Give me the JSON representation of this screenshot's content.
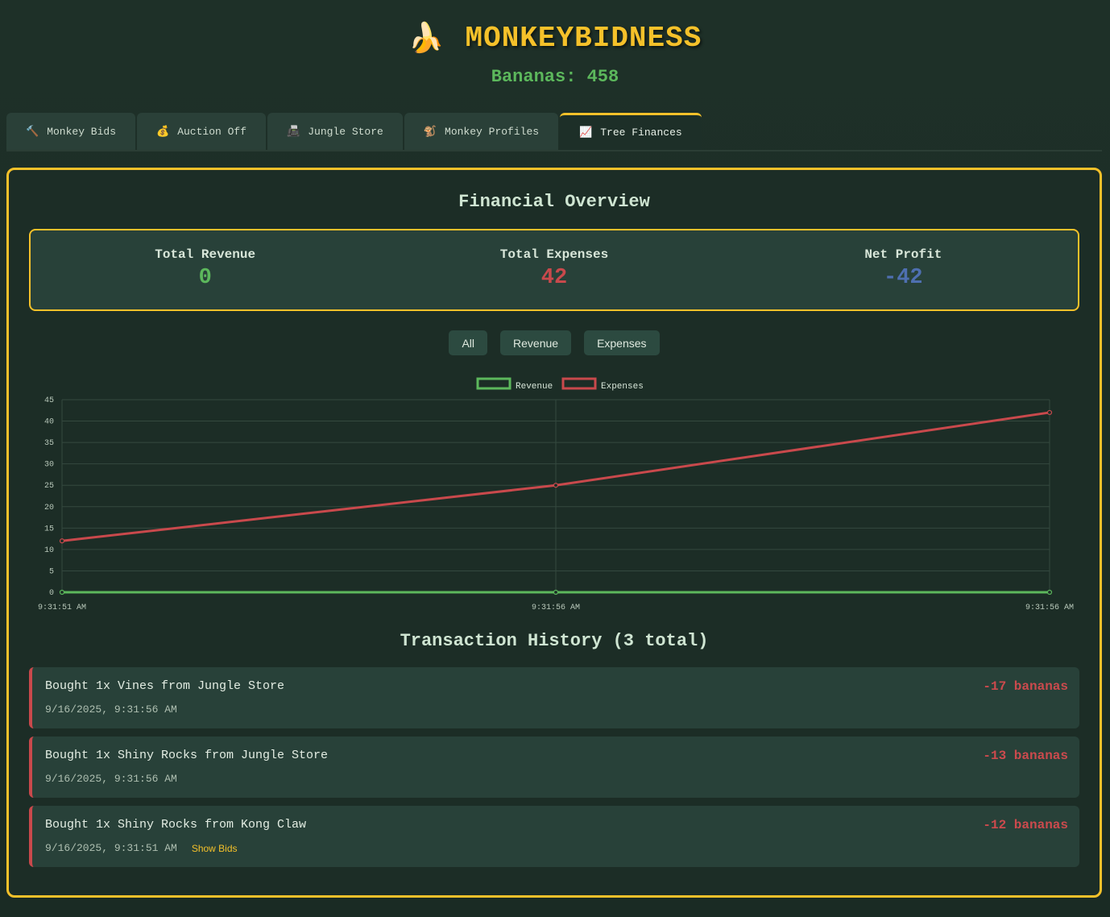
{
  "header": {
    "icon": "banana-icon",
    "title": "MONKEYBIDNESS",
    "bananas_label": "Bananas: 458"
  },
  "tabs": [
    {
      "icon": "hammer-icon",
      "glyph": "🔨",
      "label": "Monkey Bids",
      "active": false
    },
    {
      "icon": "money-bag-icon",
      "glyph": "💰",
      "label": "Auction Off",
      "active": false
    },
    {
      "icon": "cash-register-icon",
      "glyph": "📠",
      "label": "Jungle Store",
      "active": false
    },
    {
      "icon": "monkey-icon",
      "glyph": "🐒",
      "label": "Monkey Profiles",
      "active": false
    },
    {
      "icon": "chart-increasing-icon",
      "glyph": "📈",
      "label": "Tree Finances",
      "active": true
    }
  ],
  "overview": {
    "title": "Financial Overview",
    "revenue_label": "Total Revenue",
    "revenue_value": "0",
    "expenses_label": "Total Expenses",
    "expenses_value": "42",
    "profit_label": "Net Profit",
    "profit_value": "-42"
  },
  "filters": [
    "All",
    "Revenue",
    "Expenses"
  ],
  "colors": {
    "accent": "#f5c12a",
    "revenue": "#5cb85c",
    "expenses": "#c9494c",
    "profit": "#4e6fb0"
  },
  "chart_data": {
    "type": "line",
    "x": [
      "9:31:51 AM",
      "9:31:56 AM",
      "9:31:56 AM"
    ],
    "series": [
      {
        "name": "Revenue",
        "values": [
          0,
          0,
          0
        ],
        "color": "#5cb85c"
      },
      {
        "name": "Expenses",
        "values": [
          12,
          25,
          42
        ],
        "color": "#c9494c"
      }
    ],
    "ylim": [
      0,
      45
    ],
    "yticks": [
      0,
      5,
      10,
      15,
      20,
      25,
      30,
      35,
      40,
      45
    ],
    "grid": true,
    "legend": "top-center"
  },
  "history": {
    "title": "Transaction History (3 total)",
    "items": [
      {
        "desc": "Bought 1x Vines from Jungle Store",
        "time": "9/16/2025, 9:31:56 AM",
        "amount": "-17 bananas",
        "show_bids": ""
      },
      {
        "desc": "Bought 1x Shiny Rocks from Jungle Store",
        "time": "9/16/2025, 9:31:56 AM",
        "amount": "-13 bananas",
        "show_bids": ""
      },
      {
        "desc": "Bought 1x Shiny Rocks from Kong Claw",
        "time": "9/16/2025, 9:31:51 AM",
        "amount": "-12 bananas",
        "show_bids": "Show Bids"
      }
    ]
  }
}
